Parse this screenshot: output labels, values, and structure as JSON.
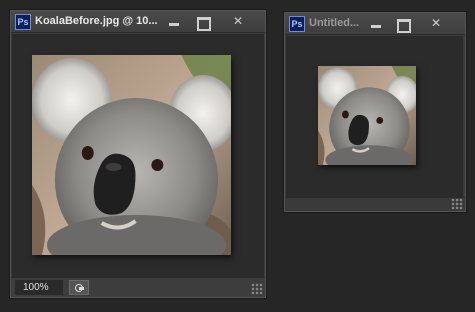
{
  "window_large": {
    "app_icon": "Ps",
    "title": "KoalaBefore.jpg @ 10...",
    "zoom_value": "100%"
  },
  "window_small": {
    "app_icon": "Ps",
    "title": "Untitled..."
  },
  "icons": {
    "minimize": "minimize-icon",
    "maximize": "maximize-icon",
    "close": "close-icon"
  }
}
